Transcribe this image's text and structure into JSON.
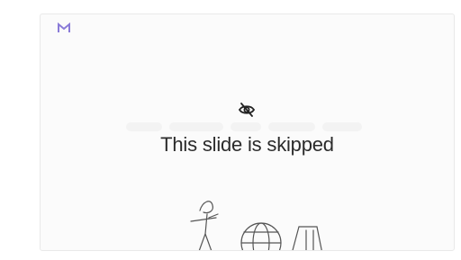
{
  "slide": {
    "status_text": "This slide is skipped",
    "status_icon": "eye-off-icon",
    "logo_icon": "brand-logo-icon",
    "illustration": "decorative-line-drawing"
  },
  "colors": {
    "background": "#ffffff",
    "card": "#fbfbfb",
    "card_border": "#e9e9e9",
    "text": "#2b2b2b",
    "logo_accent": "#8a7bd8"
  }
}
